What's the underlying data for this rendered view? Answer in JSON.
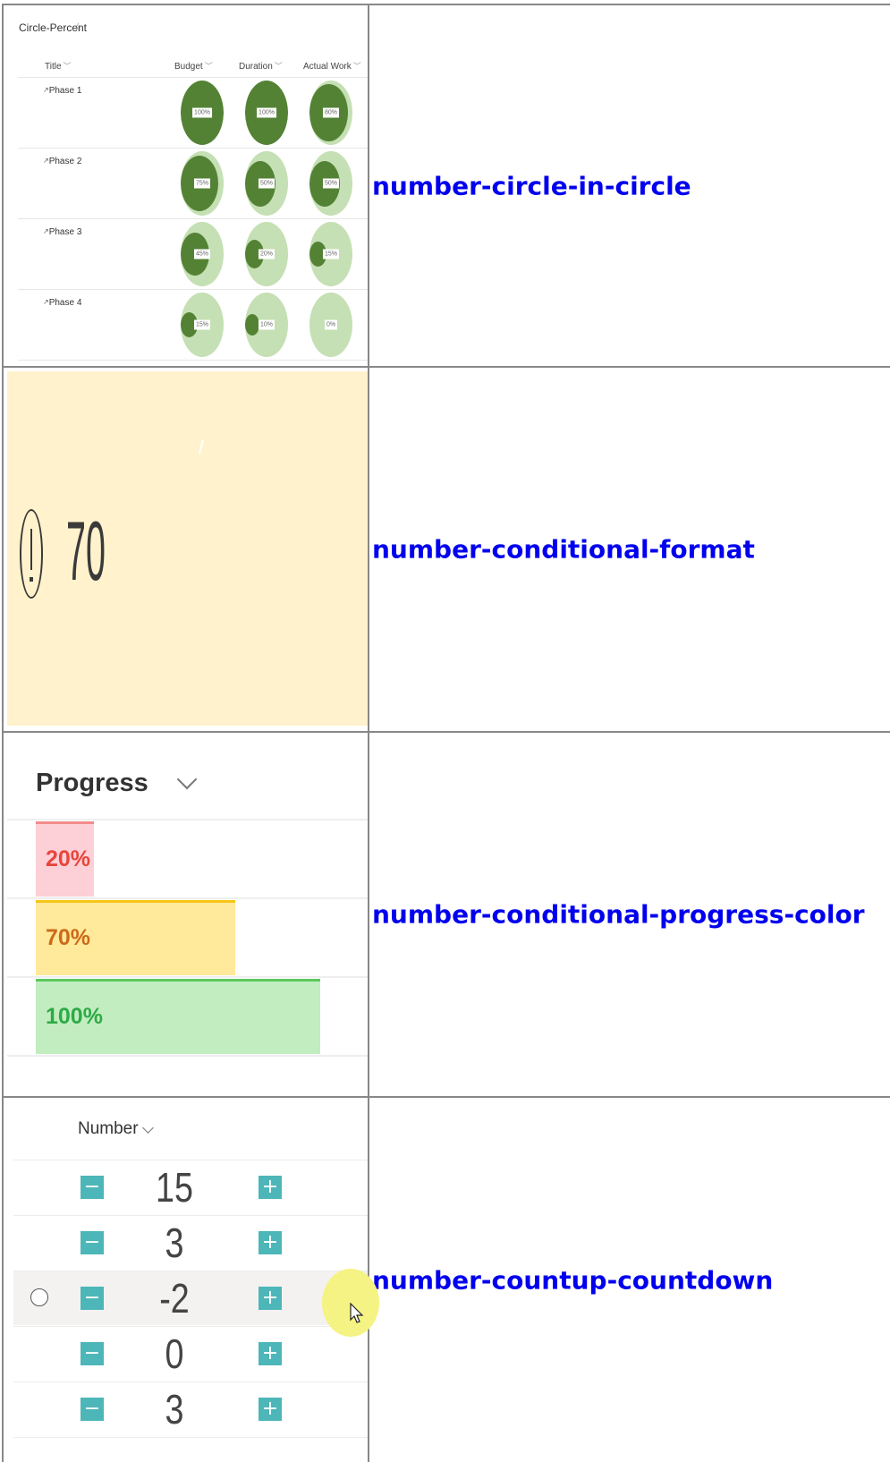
{
  "rows": [
    {
      "name": "number-circle-in-circle"
    },
    {
      "name": "number-conditional-format"
    },
    {
      "name": "number-conditional-progress-color"
    },
    {
      "name": "number-countup-countdown"
    }
  ],
  "circle_percent": {
    "title": "Circle-Percent",
    "star": "☆",
    "columns": [
      "Title",
      "Budget",
      "Duration",
      "Actual Work"
    ],
    "colors": {
      "outer": "#c5e0b4",
      "inner": "#548235"
    },
    "phases": [
      {
        "title": "Phase 1",
        "values": [
          "100%",
          "100%",
          "80%"
        ],
        "fractions": [
          1.0,
          1.0,
          0.8
        ]
      },
      {
        "title": "Phase 2",
        "values": [
          "75%",
          "50%",
          "50%"
        ],
        "fractions": [
          0.75,
          0.5,
          0.5
        ]
      },
      {
        "title": "Phase 3",
        "values": [
          "45%",
          "20%",
          "15%"
        ],
        "fractions": [
          0.45,
          0.2,
          0.15
        ]
      },
      {
        "title": "Phase 4",
        "values": [
          "15%",
          "10%",
          "0%"
        ],
        "fractions": [
          0.15,
          0.1,
          0.0
        ]
      }
    ]
  },
  "conditional_format": {
    "value": "70",
    "icon": "error-circle-icon",
    "background": "#fff2cc"
  },
  "progress": {
    "header": "Progress",
    "items": [
      {
        "label": "20%",
        "fraction": 0.2,
        "fill": "#fcd0d6",
        "border": "#f28b8b",
        "text_color": "#e8453c"
      },
      {
        "label": "70%",
        "fraction": 0.7,
        "fill": "#ffe99a",
        "border": "#f5c518",
        "text_color": "#cc6a1a"
      },
      {
        "label": "100%",
        "fraction": 1.0,
        "fill": "#c1edc0",
        "border": "#5bc85b",
        "text_color": "#2eaa45"
      }
    ]
  },
  "countup": {
    "header": "Number",
    "minus_symbol": "−",
    "plus_symbol": "+",
    "button_color": "#4db6b8",
    "values": [
      "15",
      "3",
      "-2",
      "0",
      "3"
    ],
    "selected_index": 2
  }
}
